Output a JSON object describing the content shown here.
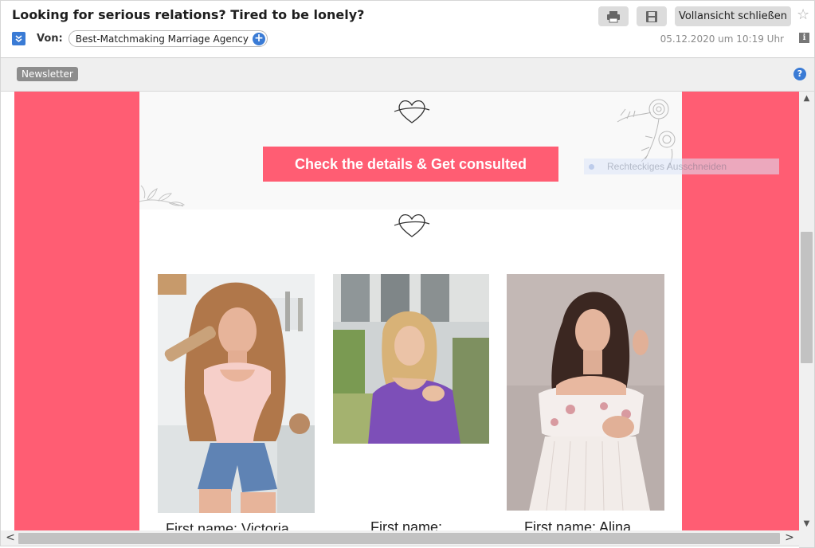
{
  "header": {
    "subject": "Looking for serious relations? Tired to be lonely?",
    "from_label": "Von:",
    "sender": "Best-Matchmaking Marriage Agency",
    "date": "05.12.2020 um 10:19 Uhr",
    "close_full_view_label": "Vollansicht schließen",
    "icons": {
      "expand": "expand-chevron-icon",
      "add_contact": "plus-circle-icon",
      "print": "printer-icon",
      "save": "floppy-disk-icon",
      "star": "star-outline-icon",
      "info": "info-icon"
    }
  },
  "tag_bar": {
    "tag": "Newsletter",
    "help_icon": "help-circle-icon",
    "help_glyph": "?"
  },
  "email_body": {
    "cta_label": "Check the details & Get consulted",
    "accent_color": "#ff5d73",
    "overlay_tooltip": "Rechteckiges Ausschneiden",
    "profiles": [
      {
        "name": "First name: Victoria"
      },
      {
        "name": "First name:"
      },
      {
        "name": "First name: Alina"
      }
    ]
  },
  "scrollbars": {
    "left_arrow": "<",
    "right_arrow": ">"
  }
}
